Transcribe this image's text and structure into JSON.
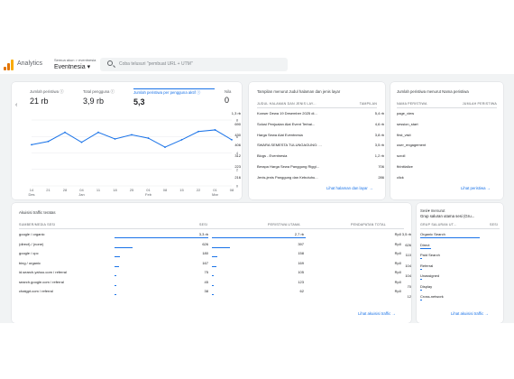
{
  "app": {
    "title": "Analytics",
    "account_small": "Semua akun > eventnesia",
    "account_name": "Eventnesia"
  },
  "search": {
    "placeholder": "Coba telusuri \"pembuat URL + UTM\""
  },
  "colors": {
    "accent": "#1a73e8",
    "logo_orange": "#f9ab00",
    "logo_dark": "#e37400"
  },
  "metrics": {
    "tabs": [
      {
        "label": "Jumlah peristiwa",
        "value": "21 rb"
      },
      {
        "label": "Total pengguna",
        "value": "3,9 rb"
      },
      {
        "label": "Jumlah peristiwa per pengguna aktif",
        "value": "5,3"
      },
      {
        "label": "Nila",
        "value": "0"
      }
    ]
  },
  "chart_data": {
    "type": "line",
    "x": [
      "14 Des",
      "21",
      "28",
      "04 Jan",
      "11",
      "18",
      "25",
      "01 Feb",
      "08",
      "15",
      "22",
      "01 Mar",
      "08"
    ],
    "series": [
      {
        "values": [
          5.0,
          5.4,
          6.5,
          5.3,
          6.5,
          5.7,
          6.2,
          5.8,
          4.7,
          5.6,
          6.6,
          6.8,
          5.6
        ]
      }
    ],
    "ylim": [
      0,
      8
    ],
    "yticks": [
      "8",
      "6",
      "4",
      "2",
      "0"
    ],
    "grid": true
  },
  "pages": {
    "title": "Tampilan menurut Judul halaman dan jenis layar",
    "col1": "JUDUL HALAMAN DAN JENIS LAY...",
    "col2": "TAMPILAN",
    "rows": [
      {
        "name": "Konser Dewa 19 Desember 2025 di...",
        "value": "1,3 rb"
      },
      {
        "name": "Solusi Penjualan Alat Event Terbai...",
        "value": "690"
      },
      {
        "name": "Harga Sewa Alat Eventnesia",
        "value": "430"
      },
      {
        "name": "SWARA SEMESTA TULUNGAGUNG: ...",
        "value": "406"
      },
      {
        "name": "Blogs - Eventnesia",
        "value": "312"
      },
      {
        "name": "Berapa Harga Sewa Panggung Riggi...",
        "value": "223"
      },
      {
        "name": "Jenis-jenis Panggung dan Kebutuhu...",
        "value": "216"
      }
    ],
    "link": "Lihat halaman dan layar"
  },
  "events": {
    "title": "Jumlah peristiwa menurut Nama peristiwa",
    "col1": "NAMA PERISTIWA",
    "col2": "JUMLAH PERISTIWA",
    "rows": [
      {
        "name": "page_view",
        "value": "5,4 rb"
      },
      {
        "name": "session_start",
        "value": "4,6 rb"
      },
      {
        "name": "first_visit",
        "value": "3,8 rb"
      },
      {
        "name": "user_engagement",
        "value": "3,5 rb"
      },
      {
        "name": "scroll",
        "value": "1,2 rb"
      },
      {
        "name": "fbInitialize",
        "value": "706"
      },
      {
        "name": "click",
        "value": "286"
      }
    ],
    "link": "Lihat peristiwa"
  },
  "traffic": {
    "title": "Akuisisi traffic teratas",
    "cols": [
      "SUMBER/MEDIA SESI",
      "SESI",
      "PERISTIWA UTAMA",
      "PENDAPATAN TOTAL"
    ],
    "rows": [
      {
        "name": "google / organic",
        "sessions": "3,3 rb",
        "key_events": "2,7 rb",
        "revenue": "Rp0",
        "bar": 1.0
      },
      {
        "name": "(direct) / (none)",
        "sessions": "626",
        "key_events": "397",
        "revenue": "Rp0",
        "bar": 0.19
      },
      {
        "name": "google / cpc",
        "sessions": "180",
        "key_events": "158",
        "revenue": "Rp0",
        "bar": 0.055
      },
      {
        "name": "bing / organic",
        "sessions": "167",
        "key_events": "169",
        "revenue": "Rp0",
        "bar": 0.05
      },
      {
        "name": "id.search.yahoo.com / referral",
        "sessions": "75",
        "key_events": "105",
        "revenue": "Rp0",
        "bar": 0.023
      },
      {
        "name": "search.google.com / referral",
        "sessions": "45",
        "key_events": "123",
        "revenue": "Rp0",
        "bar": 0.014
      },
      {
        "name": "chatgpt.com / referral",
        "sessions": "38",
        "key_events": "62",
        "revenue": "Rp0",
        "bar": 0.012
      }
    ],
    "link": "Lihat akuisisi traffic"
  },
  "channels": {
    "title": "Sesi▾ menurut",
    "subtitle": "Grup saluran utama sesi (Gru...",
    "col1": "GRUP SALURAN UT...",
    "col2": "SESI",
    "rows": [
      {
        "name": "Organic Search",
        "value": "3,5 rb",
        "bar": 1.0
      },
      {
        "name": "Direct",
        "value": "626",
        "bar": 0.18
      },
      {
        "name": "Paid Search",
        "value": "110",
        "bar": 0.03
      },
      {
        "name": "Referral",
        "value": "104",
        "bar": 0.03
      },
      {
        "name": "Unassigned",
        "value": "104",
        "bar": 0.03
      },
      {
        "name": "Display",
        "value": "70",
        "bar": 0.02
      },
      {
        "name": "Cross-network",
        "value": "12",
        "bar": 0.004
      }
    ],
    "link": "Lihat akuisisi traffic"
  }
}
